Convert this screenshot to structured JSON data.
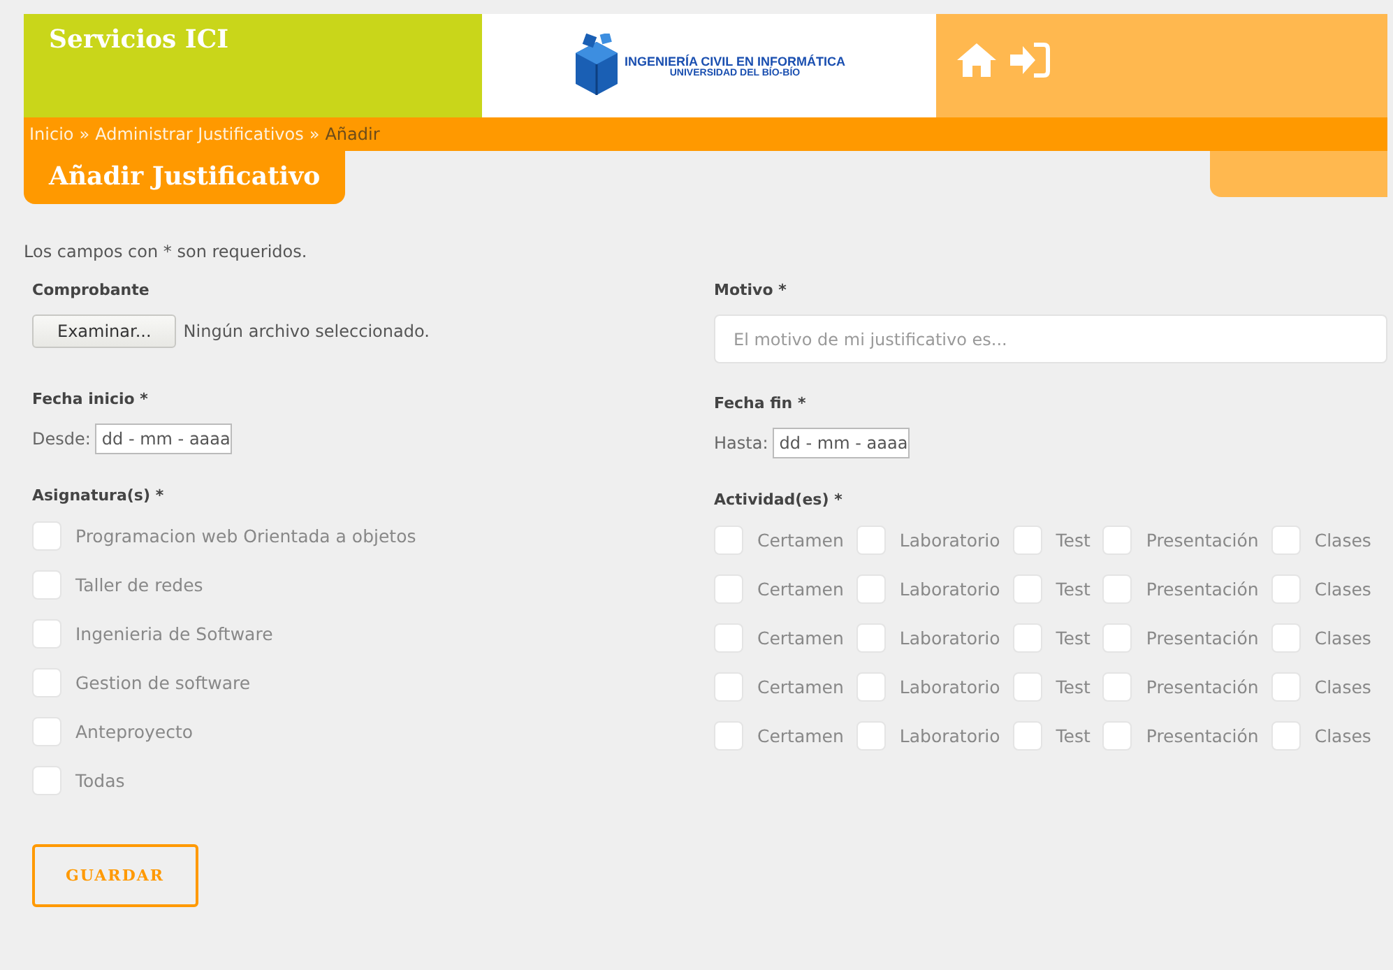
{
  "header": {
    "title": "Servicios ICI",
    "logo_line1": "INGENIERÍA CIVIL EN INFORMÁTICA",
    "logo_line2": "UNIVERSIDAD DEL BÍO-BÍO"
  },
  "breadcrumb": {
    "separator": "»",
    "items": [
      {
        "label": "Inicio",
        "current": false
      },
      {
        "label": "Administrar Justificativos",
        "current": false
      },
      {
        "label": "Añadir",
        "current": true
      }
    ]
  },
  "page_title": "Añadir Justificativo",
  "note": "Los campos con * son requeridos.",
  "comprobante": {
    "label": "Comprobante",
    "button": "Examinar...",
    "status": "Ningún archivo seleccionado."
  },
  "motivo": {
    "label": "Motivo *",
    "placeholder": "El motivo de mi justificativo es..."
  },
  "fecha_inicio": {
    "label": "Fecha inicio *",
    "prefix": "Desde:",
    "placeholder": "dd - mm - aaaa"
  },
  "fecha_fin": {
    "label": "Fecha fin *",
    "prefix": "Hasta:",
    "placeholder": "dd - mm - aaaa"
  },
  "asignaturas": {
    "label": "Asignatura(s) *",
    "items": [
      {
        "label": "Programacion web Orientada a objetos",
        "checked": false
      },
      {
        "label": "Taller de redes",
        "checked": false
      },
      {
        "label": "Ingenieria de Software",
        "checked": false
      },
      {
        "label": "Gestion de software",
        "checked": false
      },
      {
        "label": "Anteproyecto",
        "checked": false
      },
      {
        "label": "Todas",
        "checked": false
      }
    ]
  },
  "actividades": {
    "label": "Actividad(es) *",
    "rows": [
      [
        {
          "label": "Certamen",
          "checked": false
        },
        {
          "label": "Laboratorio",
          "checked": false
        },
        {
          "label": "Test",
          "checked": false
        },
        {
          "label": "Presentación",
          "checked": false
        },
        {
          "label": "Clases",
          "checked": false
        }
      ],
      [
        {
          "label": "Certamen",
          "checked": false
        },
        {
          "label": "Laboratorio",
          "checked": false
        },
        {
          "label": "Test",
          "checked": false
        },
        {
          "label": "Presentación",
          "checked": false
        },
        {
          "label": "Clases",
          "checked": false
        }
      ],
      [
        {
          "label": "Certamen",
          "checked": false
        },
        {
          "label": "Laboratorio",
          "checked": false
        },
        {
          "label": "Test",
          "checked": false
        },
        {
          "label": "Presentación",
          "checked": false
        },
        {
          "label": "Clases",
          "checked": false
        }
      ],
      [
        {
          "label": "Certamen",
          "checked": false
        },
        {
          "label": "Laboratorio",
          "checked": false
        },
        {
          "label": "Test",
          "checked": false
        },
        {
          "label": "Presentación",
          "checked": false
        },
        {
          "label": "Clases",
          "checked": false
        }
      ],
      [
        {
          "label": "Certamen",
          "checked": false
        },
        {
          "label": "Laboratorio",
          "checked": false
        },
        {
          "label": "Test",
          "checked": false
        },
        {
          "label": "Presentación",
          "checked": false
        },
        {
          "label": "Clases",
          "checked": false
        }
      ]
    ]
  },
  "submit": "GUARDAR"
}
